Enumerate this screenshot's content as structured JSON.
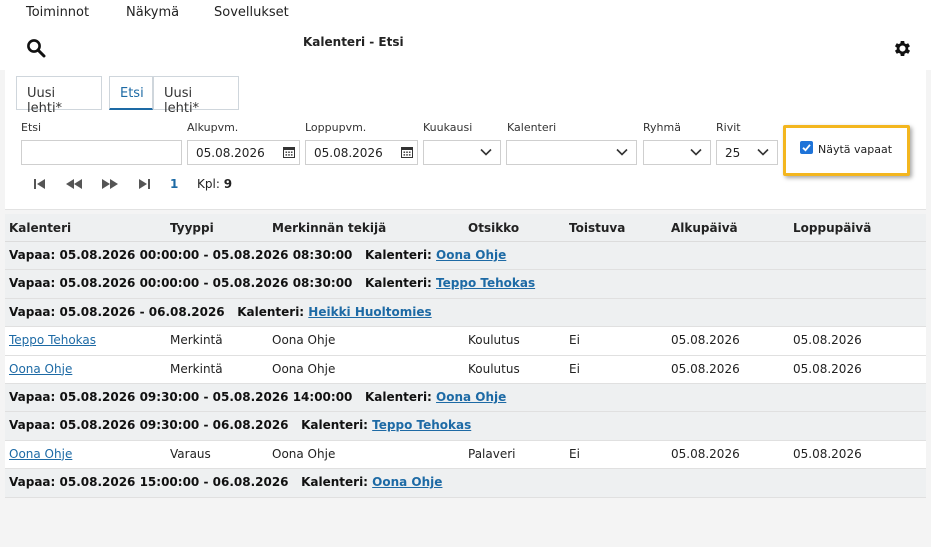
{
  "menu": [
    "Toiminnot",
    "Näkymä",
    "Sovellukset"
  ],
  "page_title": "Kalenteri - Etsi",
  "tabs": [
    {
      "label": "Uusi lehti*"
    },
    {
      "label": "Etsi"
    },
    {
      "label": "Uusi lehti*"
    }
  ],
  "filters": {
    "etsi": {
      "label": "Etsi",
      "value": ""
    },
    "alkupvm": {
      "label": "Alkupvm.",
      "value": "05.08.2026"
    },
    "loppupvm": {
      "label": "Loppupvm.",
      "value": "05.08.2026"
    },
    "kuukausi": {
      "label": "Kuukausi",
      "value": ""
    },
    "kalenteri": {
      "label": "Kalenteri",
      "value": ""
    },
    "ryhma": {
      "label": "Ryhmä",
      "value": ""
    },
    "rivit": {
      "label": "Rivit",
      "value": "25"
    }
  },
  "show_free": {
    "label": "Näytä vapaat",
    "checked": true
  },
  "pager": {
    "page": "1",
    "count_label": "Kpl:",
    "count": "9"
  },
  "columns": [
    "Kalenteri",
    "Tyyppi",
    "Merkinnän tekijä",
    "Otsikko",
    "Toistuva",
    "Alkupäivä",
    "Loppupäivä"
  ],
  "rows": [
    {
      "kind": "free",
      "text": "Vapaa: 05.08.2026 00:00:00 - 05.08.2026 08:30:00",
      "cal_label": "Kalenteri:",
      "calendar": "Oona Ohje"
    },
    {
      "kind": "free",
      "text": "Vapaa: 05.08.2026 00:00:00 - 05.08.2026 08:30:00",
      "cal_label": "Kalenteri:",
      "calendar": "Teppo Tehokas"
    },
    {
      "kind": "free",
      "text": "Vapaa: 05.08.2026 - 06.08.2026",
      "cal_label": "Kalenteri:",
      "calendar": "Heikki Huoltomies"
    },
    {
      "kind": "entry",
      "calendar": "Teppo Tehokas",
      "type": "Merkintä",
      "author": "Oona Ohje",
      "title": "Koulutus",
      "recurring": "Ei",
      "start": "05.08.2026",
      "end": "05.08.2026"
    },
    {
      "kind": "entry",
      "calendar": "Oona Ohje",
      "type": "Merkintä",
      "author": "Oona Ohje",
      "title": "Koulutus",
      "recurring": "Ei",
      "start": "05.08.2026",
      "end": "05.08.2026"
    },
    {
      "kind": "free",
      "text": "Vapaa: 05.08.2026 09:30:00 - 05.08.2026 14:00:00",
      "cal_label": "Kalenteri:",
      "calendar": "Oona Ohje"
    },
    {
      "kind": "free",
      "text": "Vapaa: 05.08.2026 09:30:00 - 06.08.2026",
      "cal_label": "Kalenteri:",
      "calendar": "Teppo Tehokas"
    },
    {
      "kind": "entry",
      "calendar": "Oona Ohje",
      "type": "Varaus",
      "author": "Oona Ohje",
      "title": "Palaveri",
      "recurring": "Ei",
      "start": "05.08.2026",
      "end": "05.08.2026"
    },
    {
      "kind": "free",
      "text": "Vapaa: 05.08.2026 15:00:00 - 06.08.2026",
      "cal_label": "Kalenteri:",
      "calendar": "Oona Ohje"
    }
  ],
  "colors": {
    "accent": "#1d6aa5",
    "highlight": "#f3b61f",
    "group_bg": "#eef0f1"
  },
  "icons": {
    "search": "search-icon",
    "settings": "gear-icon",
    "calendar": "calendar-icon",
    "dropdown": "chevron-down-icon",
    "first": "first-page-icon",
    "prev": "previous-page-icon",
    "next": "next-page-icon",
    "last": "last-page-icon"
  }
}
